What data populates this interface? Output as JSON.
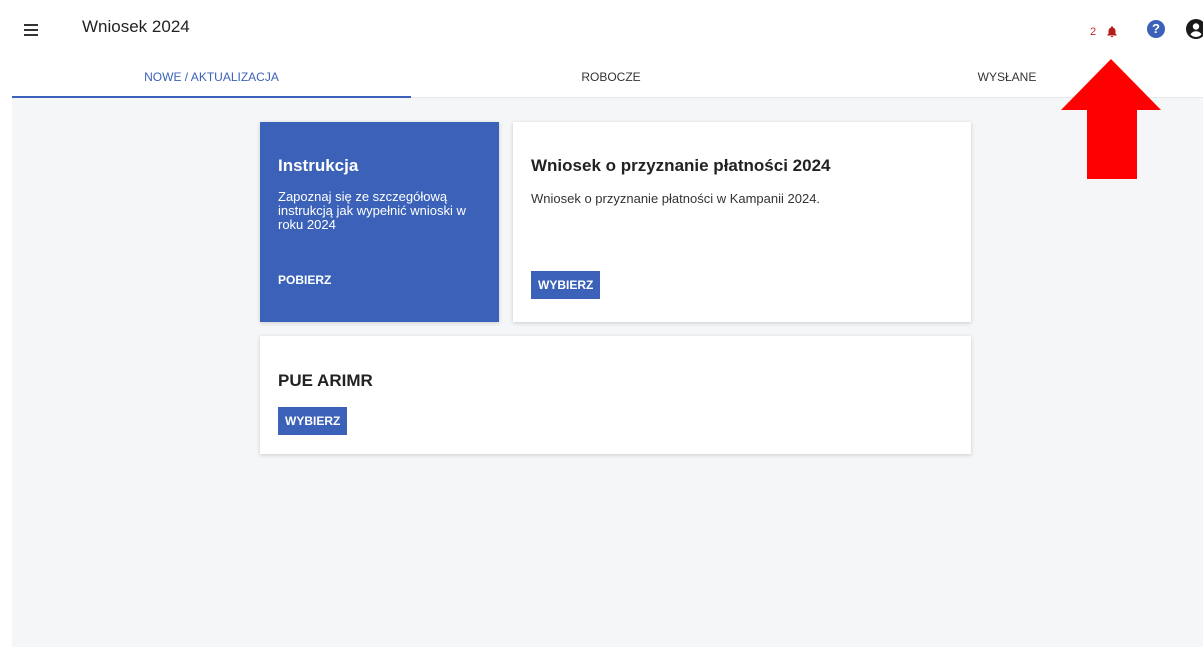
{
  "header": {
    "title": "Wniosek 2024",
    "notification_count": "2",
    "help_symbol": "?",
    "menu_icon": "hamburger-menu-icon",
    "notification_icon": "bell-icon",
    "account_icon": "account-circle-icon"
  },
  "tabs": [
    {
      "label": "NOWE / AKTUALIZACJA",
      "active": true
    },
    {
      "label": "ROBOCZE",
      "active": false
    },
    {
      "label": "WYSŁANE",
      "active": false
    }
  ],
  "cards": {
    "instruction": {
      "title": "Instrukcja",
      "description": "Zapoznaj się ze szczegółową instrukcją jak wypełnić wnioski w roku 2024",
      "action": "POBIERZ"
    },
    "application": {
      "title": "Wniosek o przyznanie płatności 2024",
      "description": "Wniosek o przyznanie płatności w Kampanii 2024.",
      "action": "WYBIERZ"
    },
    "pue": {
      "title": "PUE ARIMR",
      "action": "WYBIERZ"
    }
  },
  "colors": {
    "accent": "#3b62b8",
    "notification": "#c62828",
    "annotation_arrow": "#ff0000",
    "background": "#f5f6f8"
  }
}
